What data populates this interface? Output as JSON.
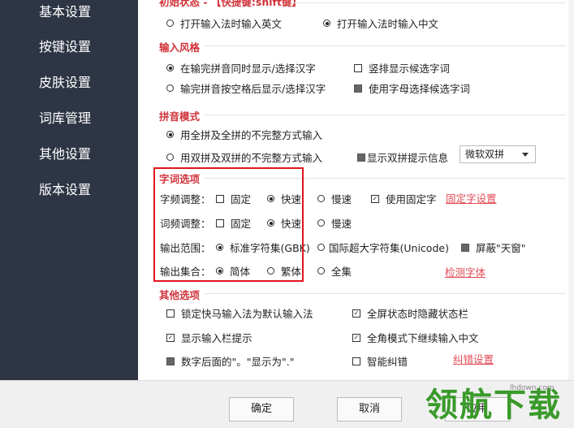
{
  "sidebar": {
    "items": [
      {
        "label": "基本设置"
      },
      {
        "label": "按键设置"
      },
      {
        "label": "皮肤设置"
      },
      {
        "label": "词库管理"
      },
      {
        "label": "其他设置"
      },
      {
        "label": "版本设置"
      }
    ]
  },
  "initial_state": {
    "title_partial": "初始状态 - 【快捷键:shift键】",
    "opt_english": "打开输入法时输入英文",
    "opt_chinese": "打开输入法时输入中文"
  },
  "input_style": {
    "title": "输入风格",
    "opt1": "在输完拼音同时显示/选择汉字",
    "opt2": "输完拼音按空格后显示/选择汉字",
    "vertical": "竖排显示候选字词",
    "letter_select": "使用字母选择候选字词"
  },
  "pinyin_mode": {
    "title": "拼音模式",
    "opt_full": "用全拼及全拼的不完整方式输入",
    "opt_double": "用双拼及双拼的不完整方式输入",
    "show_double_hint": "显示双拼提示信息",
    "scheme_selected": "微软双拼"
  },
  "word_options": {
    "title": "字词选项",
    "char_freq_label": "字频调整：",
    "word_freq_label": "词频调整：",
    "output_range_label": "输出范围：",
    "output_set_label": "输出集合：",
    "fixed": "固定",
    "fast": "快速",
    "slow": "慢速",
    "use_fixed_char": "使用固定字",
    "fixed_char_settings": "固定字设置",
    "std_charset": "标准字符集(GBK)",
    "intl_charset": "国际超大字符集(Unicode)",
    "block_tianchuang": "屏蔽\"天窗\"",
    "simplified": "简体",
    "traditional": "繁体",
    "full_set": "全集",
    "detect_font": "检测字体"
  },
  "other_options": {
    "title": "其他选项",
    "lock_default": "锁定快马输入法为默认输入法",
    "fullscreen_hide": "全屏状态时隐藏状态栏",
    "show_input_hint": "显示输入栏提示",
    "fullwidth_continue": "全角模式下继续输入中文",
    "digit_period": "数字后面的\"。\"显示为\".\"",
    "smart_correct": "智能纠错",
    "correct_settings": "纠错设置"
  },
  "footer": {
    "ok": "确定",
    "cancel": "取消",
    "apply": "应用"
  },
  "watermark": {
    "text": "领航下载",
    "url": "lhdown.com"
  }
}
